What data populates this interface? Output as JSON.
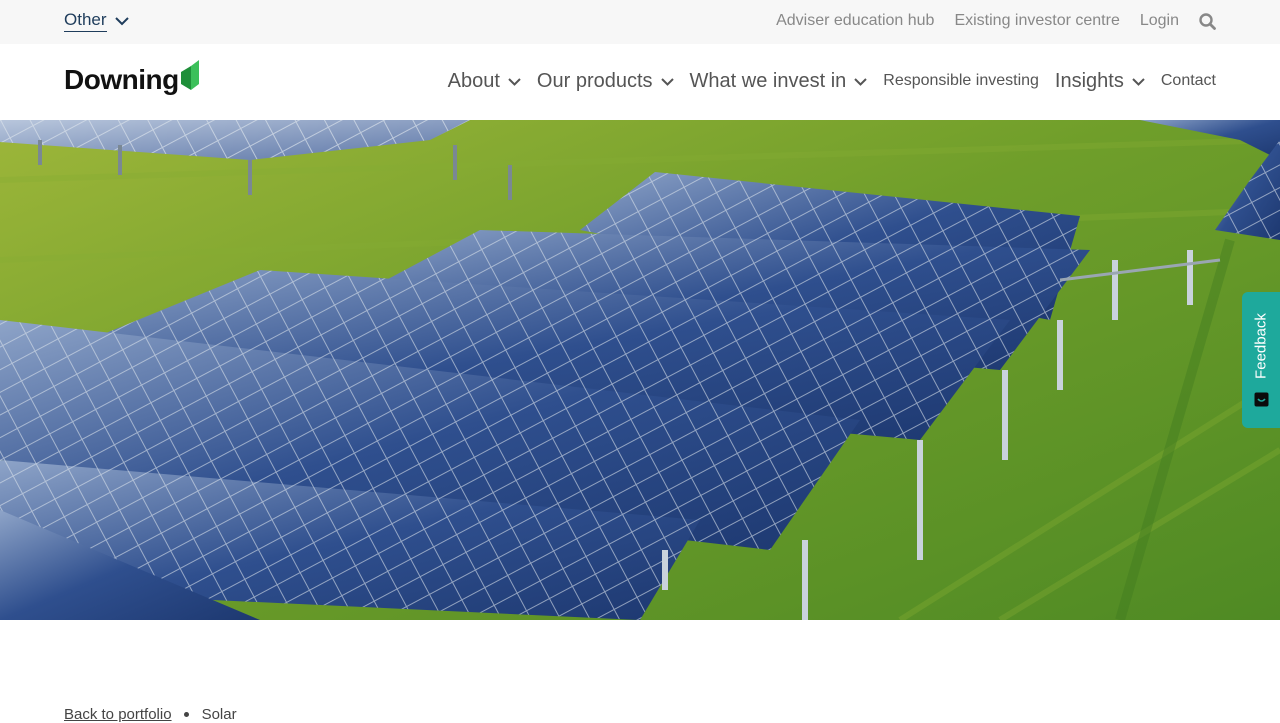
{
  "utility_bar": {
    "audience_label": "Other",
    "links": [
      "Adviser education hub",
      "Existing investor centre",
      "Login"
    ],
    "search_icon": "search-icon"
  },
  "nav": {
    "logo_text": "Downing",
    "items": [
      {
        "label": "About"
      },
      {
        "label": "Our products"
      },
      {
        "label": "What we invest in"
      },
      {
        "label": "Responsible investing"
      },
      {
        "label": "Insights"
      },
      {
        "label": "Contact"
      }
    ]
  },
  "hero": {
    "image_description": "solar-panels-in-green-field",
    "colors": {
      "grass": "#6f9e2a",
      "panel": "#2c4a86",
      "frame": "#c9d2dc"
    }
  },
  "feedback": {
    "label": "Feedback",
    "color": "#1ea99c"
  },
  "breadcrumb": {
    "back_label": "Back to portfolio",
    "current": "Solar"
  },
  "colors": {
    "brand_navy": "#1f3d5c",
    "logo_green": "#2aa848",
    "text_grey": "#888888"
  }
}
